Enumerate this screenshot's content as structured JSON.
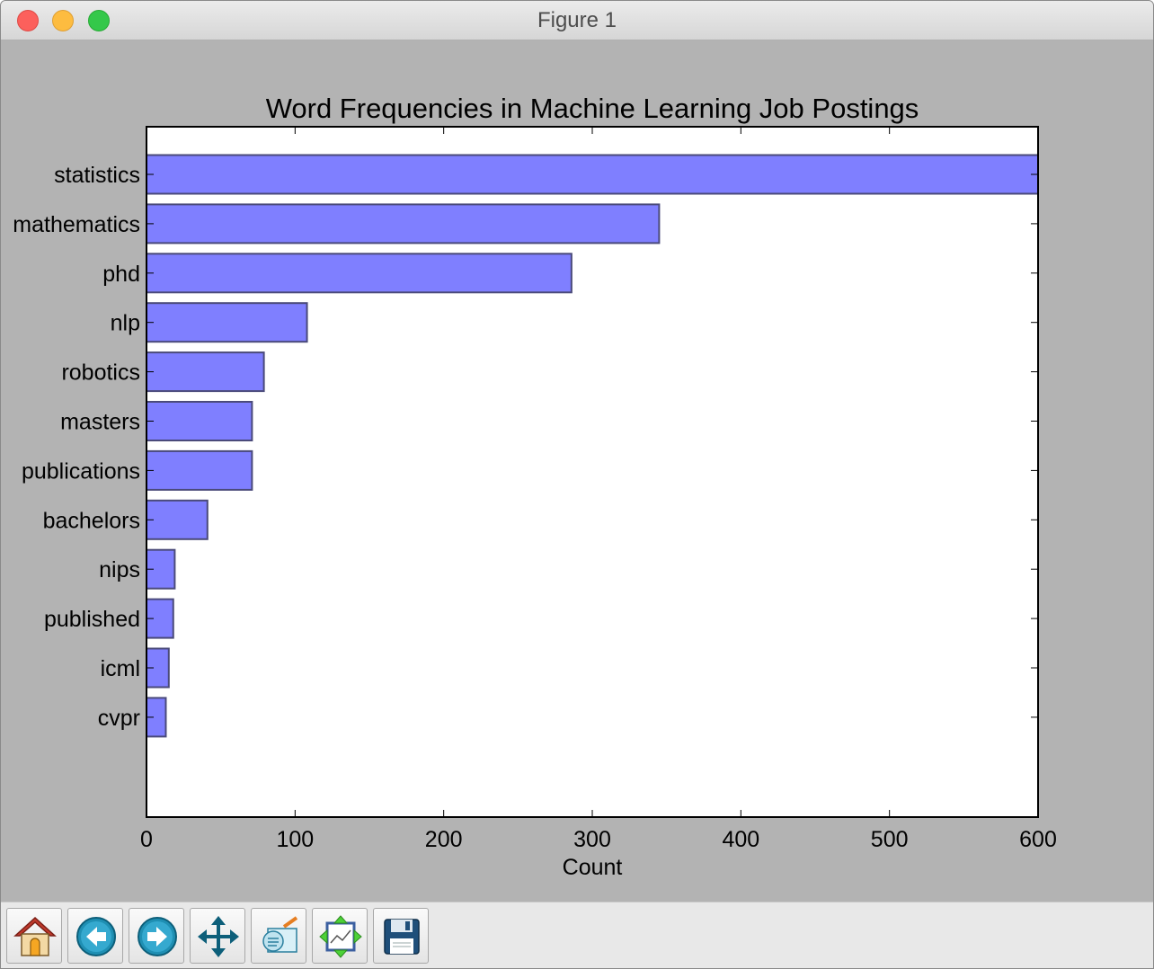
{
  "window": {
    "title": "Figure 1"
  },
  "toolbar": {
    "buttons": [
      {
        "name": "home",
        "icon": "home-icon"
      },
      {
        "name": "back",
        "icon": "back-arrow-icon"
      },
      {
        "name": "forward",
        "icon": "forward-arrow-icon"
      },
      {
        "name": "pan",
        "icon": "move-arrows-icon"
      },
      {
        "name": "zoom",
        "icon": "zoom-rect-icon"
      },
      {
        "name": "subplots",
        "icon": "subplots-config-icon"
      },
      {
        "name": "save",
        "icon": "floppy-disk-icon"
      }
    ]
  },
  "chart_data": {
    "type": "bar",
    "orientation": "horizontal",
    "title": "Word Frequencies in Machine Learning Job Postings",
    "xlabel": "Count",
    "ylabel": "",
    "xlim": [
      0,
      600
    ],
    "xticks": [
      0,
      100,
      200,
      300,
      400,
      500,
      600
    ],
    "categories": [
      "statistics",
      "mathematics",
      "phd",
      "nlp",
      "robotics",
      "masters",
      "publications",
      "bachelors",
      "nips",
      "published",
      "icml",
      "cvpr"
    ],
    "values": [
      600,
      345,
      286,
      108,
      79,
      71,
      71,
      41,
      19,
      18,
      15,
      13
    ],
    "bar_color": "#7f7fff",
    "bar_edge_color": "#4a4a7a",
    "grid": false,
    "legend": "none"
  }
}
